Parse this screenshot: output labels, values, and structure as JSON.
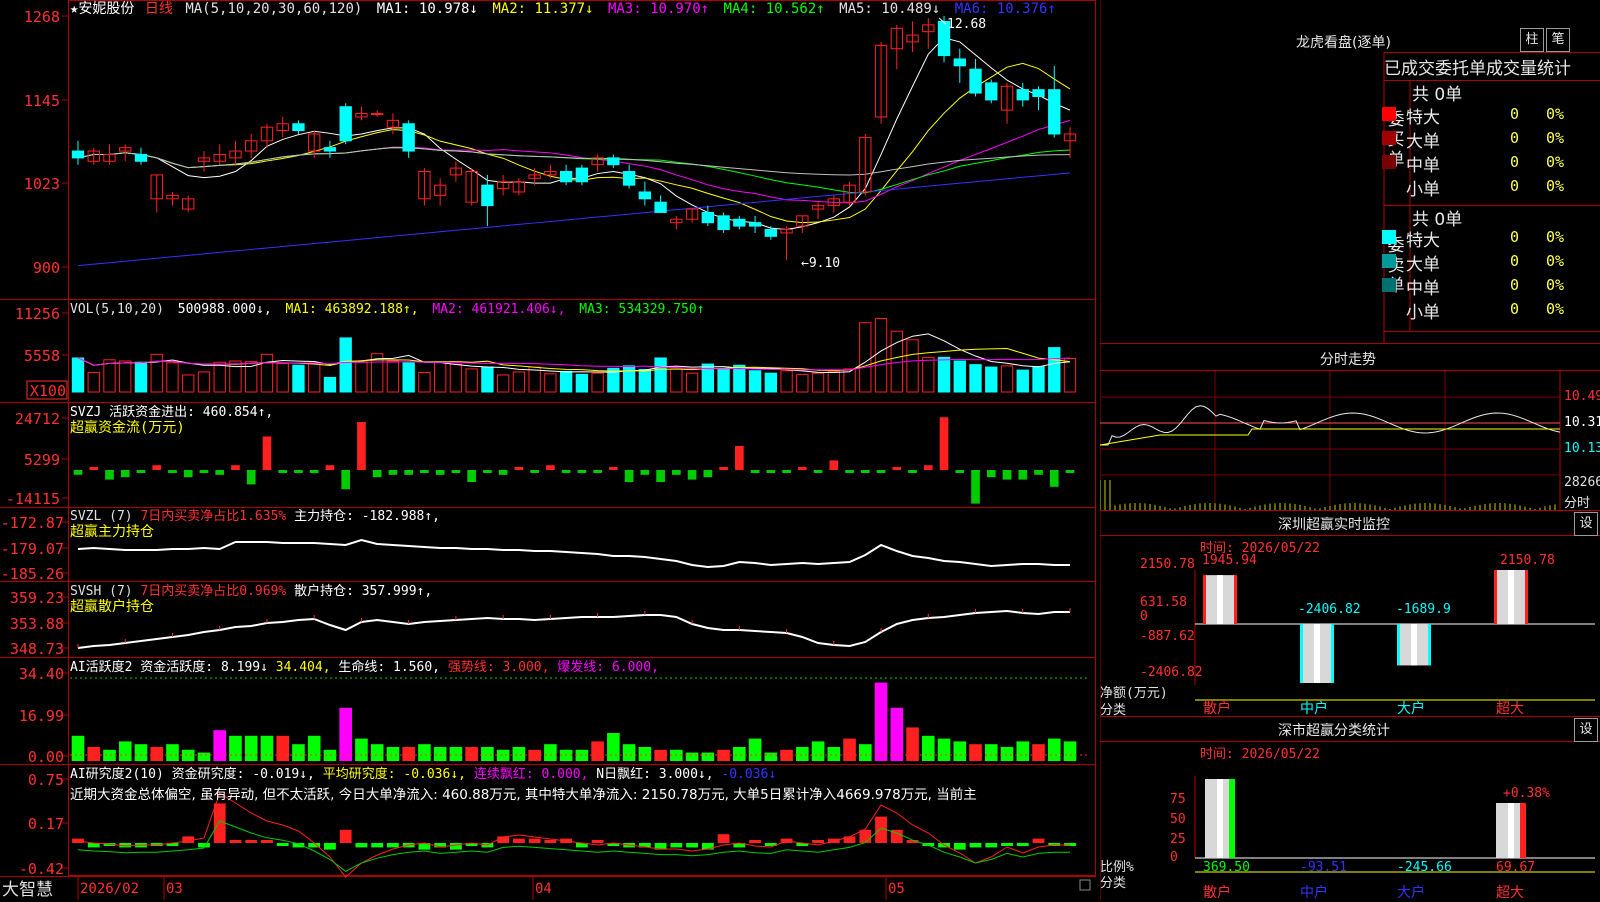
{
  "header": {
    "stock": "★安妮股份",
    "period": "日线",
    "ma_params": "MA(5,10,20,30,60,120)",
    "ma1": "MA1: 10.978↓",
    "ma2": "MA2: 11.377↓",
    "ma3": "MA3: 10.970↑",
    "ma4": "MA4: 10.562↑",
    "ma5": "MA5: 10.489↓",
    "ma6": "MA6: 10.376↑"
  },
  "price_panel": {
    "yticks": [
      "1268",
      "1145",
      "1023",
      "900"
    ],
    "ylim": [
      900,
      1268
    ],
    "high_note": "12.68",
    "low_note": "←9.10"
  },
  "volume_panel": {
    "title": "VOL(5,10,20)",
    "value": "500988.000↓,",
    "ma1": "MA1: 463892.188↑,",
    "ma2": "MA2: 461921.406↓,",
    "ma3": "MA3: 534329.750↑",
    "yticks": [
      "11256",
      "5558",
      "X100"
    ]
  },
  "svzj_panel": {
    "title": "SVZJ  活跃资金进出: 460.854↑,",
    "subtitle": "超赢资金流(万元)",
    "yticks": [
      "24712",
      "5299",
      "-14115"
    ]
  },
  "svzl_panel": {
    "title": "SVZL (7) ",
    "title_red": "7日内买卖净占比1.635%",
    "title_tail": " 主力持仓: -182.988↑,",
    "subtitle": "超赢主力持仓",
    "yticks": [
      "-172.87",
      "-179.07",
      "-185.26"
    ]
  },
  "svsh_panel": {
    "title": "SVSH (7) ",
    "title_red": "7日内买卖净占比0.969%",
    "title_tail": " 散户持仓: 357.999↑,",
    "subtitle": "超赢散户持仓",
    "yticks": [
      "359.23",
      "353.88",
      "348.73"
    ]
  },
  "ai2_panel": {
    "title": "AI活跃度2 资金活跃度: 8.199↓",
    "v2": " 34.404,",
    "v3": " 生命线: 1.560,",
    "v4": " 强势线: 3.000,",
    "v5": " 爆发线: 6.000,",
    "yticks": [
      "34.40",
      "16.99",
      "0.00"
    ]
  },
  "ai_research_panel": {
    "title": "AI研究度2(10)  资金研究度: -0.019↓,",
    "avg": " 平均研究度: -0.036↓,",
    "red1": " 连续飘红: 0.000,",
    "nred": " N日飘红: 3.000↓,",
    "last": " -0.036↓",
    "comment": "近期大资金总体偏空, 虽有异动, 但不太活跃, 今日大单净流入: 460.88万元, 其中特大单净流入: 2150.78万元, 大单5日累计净入4669.978万元, 当前主",
    "yticks": [
      "0.75",
      "0.17",
      "-0.42"
    ]
  },
  "date_axis": {
    "brand": "大智慧",
    "labels": [
      "2026/02",
      "03",
      "04",
      "05"
    ]
  },
  "right": {
    "dragon_title": "龙虎看盘(逐单)",
    "btn_zhu": "柱",
    "btn_bi": "笔",
    "order_title": "已成交委托单成交量统计",
    "buy_label": "委买单",
    "sell_label": "委卖单",
    "buy_total": "共 0单",
    "sell_total": "共 0单",
    "rows_buy": [
      {
        "name": "特大",
        "count": "0",
        "pct": "0%",
        "color": "#ff0000"
      },
      {
        "name": "大单",
        "count": "0",
        "pct": "0%",
        "color": "#a00000"
      },
      {
        "name": "中单",
        "count": "0",
        "pct": "0%",
        "color": "#780000"
      },
      {
        "name": "小单",
        "count": "0",
        "pct": "0%",
        "color": "none"
      }
    ],
    "rows_sell": [
      {
        "name": "特大",
        "count": "0",
        "pct": "0%",
        "color": "#00ffff"
      },
      {
        "name": "大单",
        "count": "0",
        "pct": "0%",
        "color": "#009a9a"
      },
      {
        "name": "中单",
        "count": "0",
        "pct": "0%",
        "color": "#007070"
      },
      {
        "name": "小单",
        "count": "0",
        "pct": "0%",
        "color": "none"
      }
    ],
    "intraday_title": "分时走势",
    "intraday_yticks": [
      "10.49",
      "10.31",
      "10.13"
    ],
    "intraday_vol": "28266",
    "intraday_vol_unit": "分时",
    "monitor_title": "深圳超赢实时监控",
    "monitor_btn": "设",
    "monitor_time": "时间: 2026/05/22",
    "monitor_yticks": [
      "2150.78",
      "631.58",
      "0",
      "-887.62",
      "-2406.82"
    ],
    "monitor_unit": "净额(万元)",
    "monitor_cat": "分类",
    "monitor_values": [
      "1945.94",
      "-2406.82",
      "-1689.9",
      "2150.78"
    ],
    "categories": [
      "散户",
      "中户",
      "大户",
      "超大"
    ],
    "class_title": "深市超赢分类统计",
    "class_btn": "设",
    "class_time": "时间: 2026/05/22",
    "class_yticks": [
      "75",
      "50",
      "25",
      "0"
    ],
    "class_unit": "比例%",
    "class_cat": "分类",
    "class_pct_note": "+0.38%",
    "class_values": [
      "369.50",
      "-93.51",
      "-245.66",
      "69.67"
    ]
  },
  "chart_data": [
    {
      "type": "candlestick",
      "title": "安妮股份 日线",
      "ylim": [
        9.0,
        12.68
      ],
      "high": 12.68,
      "low": 9.1,
      "candles_ohlc": [
        [
          10.7,
          10.85,
          10.5,
          10.6
        ],
        [
          10.55,
          10.75,
          10.5,
          10.7
        ],
        [
          10.55,
          10.8,
          10.5,
          10.65
        ],
        [
          10.7,
          10.8,
          10.55,
          10.75
        ],
        [
          10.65,
          10.75,
          10.5,
          10.55
        ],
        [
          10.0,
          10.35,
          9.8,
          10.35
        ],
        [
          10.0,
          10.1,
          9.9,
          10.05
        ],
        [
          9.85,
          10.05,
          9.8,
          10.0
        ],
        [
          10.55,
          10.7,
          10.4,
          10.6
        ],
        [
          10.55,
          10.8,
          10.5,
          10.65
        ],
        [
          10.6,
          10.85,
          10.5,
          10.7
        ],
        [
          10.7,
          10.95,
          10.6,
          10.85
        ],
        [
          10.85,
          11.1,
          10.75,
          11.05
        ],
        [
          11.0,
          11.2,
          10.9,
          11.1
        ],
        [
          11.1,
          11.15,
          10.95,
          11.0
        ],
        [
          10.7,
          11.0,
          10.6,
          10.95
        ],
        [
          10.75,
          10.85,
          10.6,
          10.7
        ],
        [
          11.35,
          11.4,
          10.8,
          10.85
        ],
        [
          11.2,
          11.35,
          11.15,
          11.25
        ],
        [
          11.25,
          11.3,
          11.2,
          11.25
        ],
        [
          11.05,
          11.25,
          10.95,
          11.15
        ],
        [
          11.1,
          11.15,
          10.6,
          10.7
        ],
        [
          10.0,
          10.45,
          9.9,
          10.4
        ],
        [
          10.05,
          10.3,
          9.9,
          10.2
        ],
        [
          10.35,
          10.55,
          10.25,
          10.45
        ],
        [
          9.95,
          10.45,
          9.9,
          10.4
        ],
        [
          10.2,
          10.35,
          9.6,
          9.9
        ],
        [
          10.15,
          10.35,
          10.05,
          10.25
        ],
        [
          10.1,
          10.3,
          10.05,
          10.25
        ],
        [
          10.3,
          10.45,
          10.2,
          10.35
        ],
        [
          10.35,
          10.5,
          10.3,
          10.4
        ],
        [
          10.4,
          10.5,
          10.2,
          10.25
        ],
        [
          10.45,
          10.5,
          10.2,
          10.25
        ],
        [
          10.5,
          10.65,
          10.4,
          10.6
        ],
        [
          10.6,
          10.65,
          10.45,
          10.5
        ],
        [
          10.4,
          10.5,
          10.15,
          10.2
        ],
        [
          10.1,
          10.25,
          9.9,
          10.0
        ],
        [
          9.95,
          10.05,
          9.8,
          9.8
        ],
        [
          9.65,
          9.75,
          9.55,
          9.7
        ],
        [
          9.7,
          9.85,
          9.65,
          9.85
        ],
        [
          9.8,
          9.9,
          9.6,
          9.65
        ],
        [
          9.75,
          9.8,
          9.5,
          9.55
        ],
        [
          9.7,
          9.75,
          9.55,
          9.6
        ],
        [
          9.65,
          9.75,
          9.5,
          9.6
        ],
        [
          9.55,
          9.6,
          9.4,
          9.45
        ],
        [
          9.5,
          9.6,
          9.1,
          9.55
        ],
        [
          9.6,
          9.75,
          9.5,
          9.75
        ],
        [
          9.85,
          9.95,
          9.7,
          9.9
        ],
        [
          9.9,
          10.05,
          9.8,
          10.0
        ],
        [
          9.95,
          10.25,
          9.9,
          10.2
        ],
        [
          10.1,
          10.95,
          10.05,
          10.9
        ],
        [
          11.2,
          12.3,
          11.1,
          12.25
        ],
        [
          12.2,
          12.55,
          11.9,
          12.5
        ],
        [
          12.3,
          12.6,
          12.15,
          12.4
        ],
        [
          12.45,
          12.65,
          12.2,
          12.55
        ],
        [
          12.6,
          12.68,
          12.0,
          12.1
        ],
        [
          12.05,
          12.2,
          11.7,
          11.95
        ],
        [
          11.9,
          12.05,
          11.5,
          11.55
        ],
        [
          11.7,
          11.75,
          11.4,
          11.45
        ],
        [
          11.3,
          11.7,
          11.1,
          11.65
        ],
        [
          11.6,
          11.7,
          11.35,
          11.45
        ],
        [
          11.6,
          11.65,
          11.3,
          11.5
        ],
        [
          11.6,
          11.95,
          10.9,
          10.95
        ],
        [
          10.85,
          11.05,
          10.6,
          10.95
        ]
      ],
      "ma_colors": [
        "#ffffff",
        "#ffff00",
        "#ff00ff",
        "#00ff00",
        "#c0c0c0",
        "#3333ff"
      ]
    },
    {
      "type": "bar",
      "title": "VOL(5,10,20)",
      "ylim": [
        0,
        13000
      ],
      "values": [
        5600,
        3200,
        5300,
        5100,
        4900,
        6200,
        4800,
        2800,
        3300,
        4900,
        5100,
        5000,
        6200,
        4700,
        4400,
        4800,
        2400,
        8900,
        5000,
        6300,
        5100,
        4800,
        3200,
        4900,
        4600,
        3800,
        4100,
        2800,
        3300,
        4100,
        3000,
        3400,
        2900,
        3100,
        3900,
        4300,
        3700,
        5600,
        3800,
        3100,
        4600,
        3800,
        4400,
        3500,
        3100,
        3500,
        2900,
        3100,
        3400,
        3800,
        11400,
        12100,
        10000,
        8600,
        5700,
        5700,
        5100,
        4500,
        4100,
        4300,
        3600,
        4200,
        7300,
        5500
      ],
      "colors_up": "#ff2020",
      "colors_down": "#00ffff"
    },
    {
      "type": "bar",
      "title": "SVZJ",
      "values": [
        -2,
        1,
        -4,
        -3,
        -1,
        2,
        -1,
        -3,
        -1,
        -2,
        2,
        -6,
        14,
        -1,
        -1,
        -1,
        2,
        -8,
        20,
        -3,
        -2,
        -2,
        -1,
        -2,
        -1,
        -5,
        -1,
        -2,
        1,
        -1,
        2,
        -1,
        -1,
        -1,
        1,
        -5,
        -2,
        -5,
        -2,
        -4,
        -3,
        1,
        10,
        -1,
        -1,
        -1,
        1,
        -1,
        4,
        -1,
        -1,
        -1,
        1,
        -1,
        2,
        22,
        -1,
        -14,
        -3,
        -4,
        -4,
        -2,
        -7,
        -1
      ],
      "ylim": [
        -14115,
        24712
      ]
    }
  ]
}
